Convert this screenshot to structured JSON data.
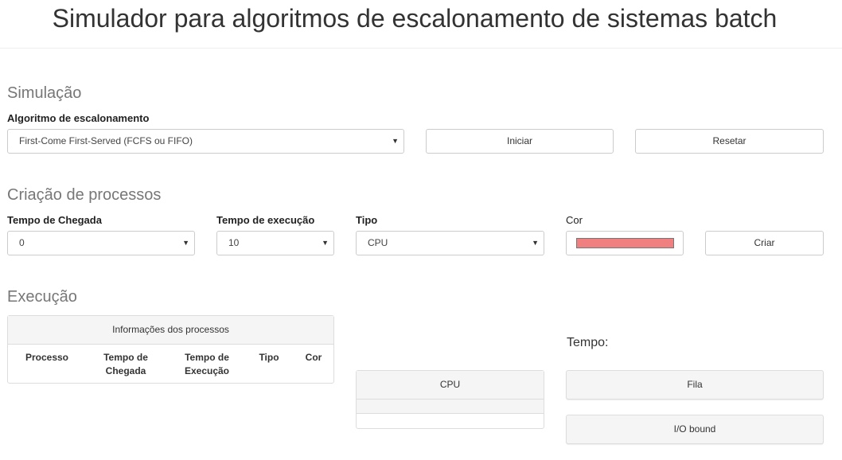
{
  "header": {
    "title": "Simulador para algoritmos de escalonamento de sistemas batch"
  },
  "simulacao": {
    "title": "Simulação",
    "algorithm_label": "Algoritmo de escalonamento",
    "algorithm_value": "First-Come First-Served (FCFS ou FIFO)",
    "start_button": "Iniciar",
    "reset_button": "Resetar"
  },
  "criacao": {
    "title": "Criação de processos",
    "arrival_label": "Tempo de Chegada",
    "arrival_value": "0",
    "exec_label": "Tempo de execução",
    "exec_value": "10",
    "type_label": "Tipo",
    "type_value": "CPU",
    "color_label": "Cor",
    "color_value": "#f08080",
    "create_button": "Criar"
  },
  "execucao": {
    "title": "Execução",
    "info_panel_title": "Informações dos processos",
    "columns": [
      "Processo",
      "Tempo de Chegada",
      "Tempo de Execução",
      "Tipo",
      "Cor"
    ],
    "cpu_label": "CPU",
    "time_label": "Tempo:",
    "queue_label": "Fila",
    "io_label": "I/O bound"
  }
}
